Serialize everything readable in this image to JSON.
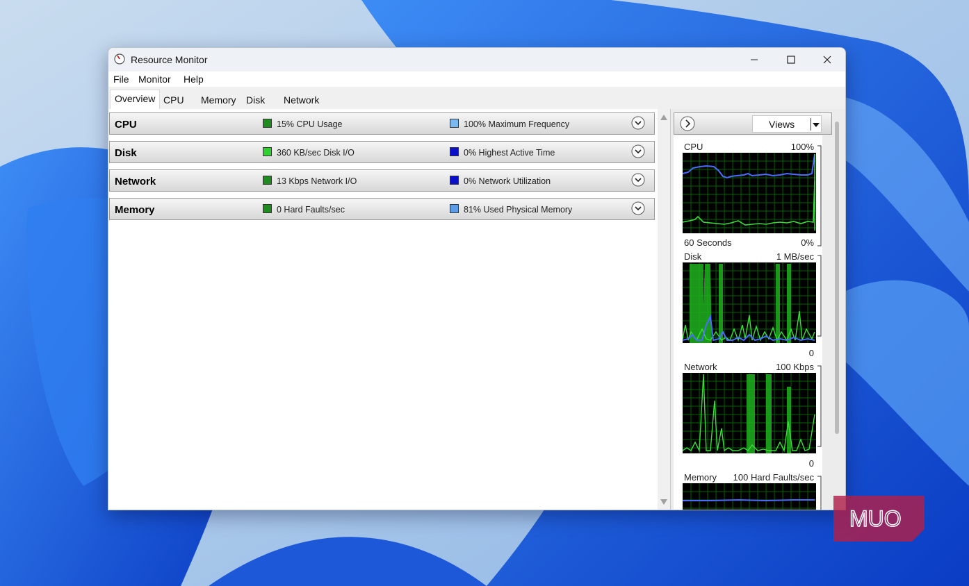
{
  "window": {
    "title": "Resource Monitor"
  },
  "menu": [
    "File",
    "Monitor",
    "Help"
  ],
  "tabs": [
    "Overview",
    "CPU",
    "Memory",
    "Disk",
    "Network"
  ],
  "sections": [
    {
      "title": "CPU",
      "stat1": "15% CPU Usage",
      "stat2": "100% Maximum Frequency",
      "swatch1": "#1e8c1e",
      "swatch2": "#7ab9f0"
    },
    {
      "title": "Disk",
      "stat1": "360 KB/sec Disk I/O",
      "stat2": "0% Highest Active Time",
      "swatch1": "#2fd02f",
      "swatch2": "#0a10c8"
    },
    {
      "title": "Network",
      "stat1": "13 Kbps Network I/O",
      "stat2": "0% Network Utilization",
      "swatch1": "#1e8c1e",
      "swatch2": "#0a10c8"
    },
    {
      "title": "Memory",
      "stat1": "0 Hard Faults/sec",
      "stat2": "81% Used Physical Memory",
      "swatch1": "#1e8c1e",
      "swatch2": "#5a9ce8"
    }
  ],
  "right_panel": {
    "views_label": "Views"
  },
  "graphs": [
    {
      "name": "CPU",
      "max": "100%",
      "bottom_left": "60 Seconds",
      "bottom_right": "0%"
    },
    {
      "name": "Disk",
      "max": "1 MB/sec",
      "bottom_left": "",
      "bottom_right": "0"
    },
    {
      "name": "Network",
      "max": "100 Kbps",
      "bottom_left": "",
      "bottom_right": "0"
    },
    {
      "name": "Memory",
      "max": "100 Hard Faults/sec",
      "bottom_left": "",
      "bottom_right": ""
    }
  ],
  "watermark": {
    "text": "MUO"
  },
  "colors": {
    "graph_bg": "#000000",
    "graph_grid": "#008000",
    "graph_green": "#3ddc3d",
    "graph_blue": "#4a6cff",
    "wallpaper": "#1a5fe0"
  }
}
